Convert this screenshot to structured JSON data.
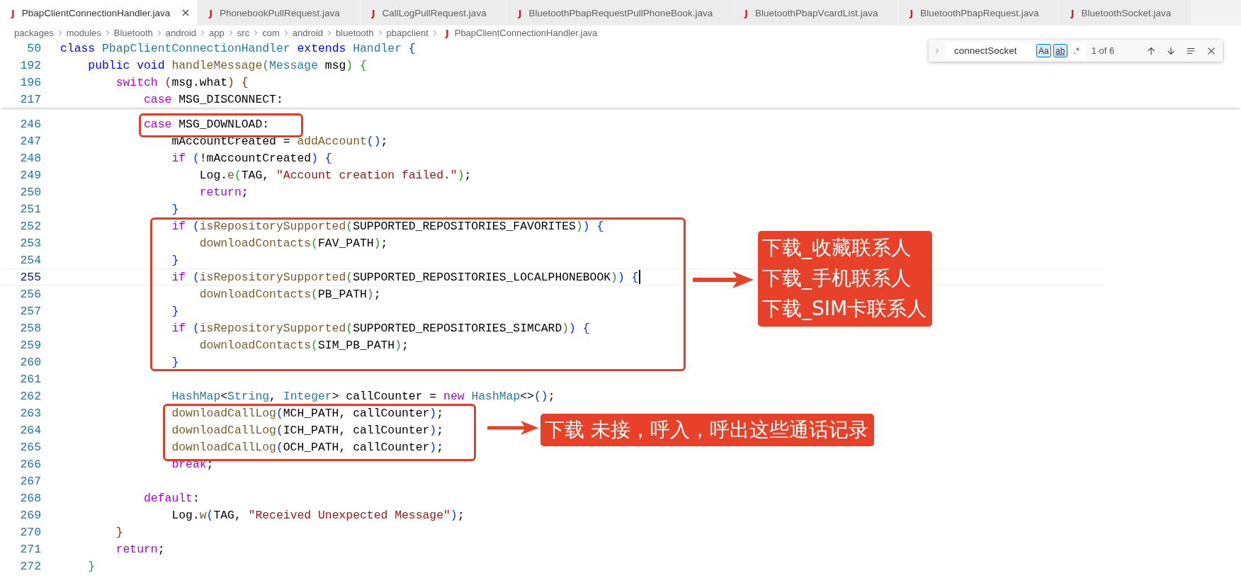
{
  "tabs": [
    {
      "icon": "J",
      "label": "PbapClientConnectionHandler.java",
      "selected": true
    },
    {
      "icon": "J",
      "label": "PhonebookPullRequest.java",
      "selected": false
    },
    {
      "icon": "J",
      "label": "CallLogPullRequest.java",
      "selected": false
    },
    {
      "icon": "J",
      "label": "BluetoothPbapRequestPullPhoneBook.java",
      "selected": false
    },
    {
      "icon": "J",
      "label": "BluetoothPbapVcardList.java",
      "selected": false
    },
    {
      "icon": "J",
      "label": "BluetoothPbapRequest.java",
      "selected": false
    },
    {
      "icon": "J",
      "label": "BluetoothSocket.java",
      "selected": false
    }
  ],
  "breadcrumb": {
    "folders": [
      "packages",
      "modules",
      "Bluetooth",
      "android",
      "app",
      "src",
      "com",
      "android",
      "bluetooth",
      "pbapclient"
    ],
    "file": {
      "icon": "J",
      "label": "PbapClientConnectionHandler.java"
    }
  },
  "find_widget": {
    "value": "connectSocket",
    "match_case": {
      "label": "Aa",
      "selected": true
    },
    "whole_word": {
      "label": "ab",
      "selected": true
    },
    "regex": {
      "label": ".*",
      "selected": false
    },
    "result": "1 of 6"
  },
  "sticky_lines": [
    {
      "number": "50",
      "tokens": [
        {
          "kind": "declaration",
          "text": "class "
        },
        {
          "kind": "type",
          "text": "PbapClientConnectionHandler "
        },
        {
          "kind": "declaration",
          "text": "extends "
        },
        {
          "kind": "type",
          "text": "Handler "
        },
        {
          "kind": "bracket1",
          "text": "{"
        }
      ]
    },
    {
      "number": "192",
      "tokens": [
        {
          "kind": "declaration",
          "text": "    public void "
        },
        {
          "kind": "method",
          "text": "handleMessage"
        },
        {
          "kind": "bracket2",
          "text": "("
        },
        {
          "kind": "type",
          "text": "Message"
        },
        {
          "kind": "plain",
          "text": " msg"
        },
        {
          "kind": "bracket2",
          "text": ") {"
        }
      ]
    },
    {
      "number": "196",
      "tokens": [
        {
          "kind": "keyword",
          "text": "        switch "
        },
        {
          "kind": "bracket3",
          "text": "("
        },
        {
          "kind": "plain",
          "text": "msg.what"
        },
        {
          "kind": "bracket3",
          "text": ") {"
        }
      ]
    },
    {
      "number": "217",
      "tokens": [
        {
          "kind": "keyword",
          "text": "            case"
        },
        {
          "kind": "plain",
          "text": " MSG_DISCONNECT:"
        }
      ]
    }
  ],
  "lines": [
    {
      "number": "246",
      "current": false,
      "tokens": [
        {
          "kind": "keyword",
          "text": "            case"
        },
        {
          "kind": "plain",
          "text": " MSG_DOWNLOAD:"
        }
      ]
    },
    {
      "number": "247",
      "current": false,
      "tokens": [
        {
          "kind": "plain",
          "text": "                mAccountCreated = "
        },
        {
          "kind": "method",
          "text": "addAccount"
        },
        {
          "kind": "bracket1",
          "text": "()"
        },
        {
          "kind": "plain",
          "text": ";"
        }
      ]
    },
    {
      "number": "248",
      "current": false,
      "tokens": [
        {
          "kind": "keyword",
          "text": "                if "
        },
        {
          "kind": "bracket1",
          "text": "("
        },
        {
          "kind": "plain",
          "text": "!mAccountCreated"
        },
        {
          "kind": "bracket1",
          "text": ") {"
        }
      ]
    },
    {
      "number": "249",
      "current": false,
      "tokens": [
        {
          "kind": "plain",
          "text": "                    Log."
        },
        {
          "kind": "method",
          "text": "e"
        },
        {
          "kind": "bracket2",
          "text": "("
        },
        {
          "kind": "plain",
          "text": "TAG, "
        },
        {
          "kind": "string",
          "text": "\"Account creation failed.\""
        },
        {
          "kind": "bracket2",
          "text": ")"
        },
        {
          "kind": "plain",
          "text": ";"
        }
      ]
    },
    {
      "number": "250",
      "current": false,
      "tokens": [
        {
          "kind": "keyword",
          "text": "                    return"
        },
        {
          "kind": "plain",
          "text": ";"
        }
      ]
    },
    {
      "number": "251",
      "current": false,
      "tokens": [
        {
          "kind": "bracket1",
          "text": "                }"
        }
      ]
    },
    {
      "number": "252",
      "current": false,
      "tokens": [
        {
          "kind": "keyword",
          "text": "                if "
        },
        {
          "kind": "bracket1",
          "text": "("
        },
        {
          "kind": "method",
          "text": "isRepositorySupported"
        },
        {
          "kind": "bracket2",
          "text": "("
        },
        {
          "kind": "plain",
          "text": "SUPPORTED_REPOSITORIES_FAVORITES"
        },
        {
          "kind": "bracket2",
          "text": ")"
        },
        {
          "kind": "bracket1",
          "text": ") {"
        }
      ]
    },
    {
      "number": "253",
      "current": false,
      "tokens": [
        {
          "kind": "method",
          "text": "                    downloadContacts"
        },
        {
          "kind": "bracket2",
          "text": "("
        },
        {
          "kind": "plain",
          "text": "FAV_PATH"
        },
        {
          "kind": "bracket2",
          "text": ")"
        },
        {
          "kind": "plain",
          "text": ";"
        }
      ]
    },
    {
      "number": "254",
      "current": false,
      "tokens": [
        {
          "kind": "bracket1",
          "text": "                }"
        }
      ]
    },
    {
      "number": "255",
      "current": true,
      "tokens": [
        {
          "kind": "keyword",
          "text": "                if "
        },
        {
          "kind": "bracket1",
          "text": "("
        },
        {
          "kind": "method",
          "text": "isRepositorySupported"
        },
        {
          "kind": "bracket2",
          "text": "("
        },
        {
          "kind": "plain",
          "text": "SUPPORTED_REPOSITORIES_LOCALPHONEBOOK"
        },
        {
          "kind": "bracket2",
          "text": ")"
        },
        {
          "kind": "bracket1",
          "text": ") {"
        }
      ]
    },
    {
      "number": "256",
      "current": false,
      "tokens": [
        {
          "kind": "method",
          "text": "                    downloadContacts"
        },
        {
          "kind": "bracket2",
          "text": "("
        },
        {
          "kind": "plain",
          "text": "PB_PATH"
        },
        {
          "kind": "bracket2",
          "text": ")"
        },
        {
          "kind": "plain",
          "text": ";"
        }
      ]
    },
    {
      "number": "257",
      "current": false,
      "tokens": [
        {
          "kind": "bracket1",
          "text": "                }"
        }
      ]
    },
    {
      "number": "258",
      "current": false,
      "tokens": [
        {
          "kind": "keyword",
          "text": "                if "
        },
        {
          "kind": "bracket1",
          "text": "("
        },
        {
          "kind": "method",
          "text": "isRepositorySupported"
        },
        {
          "kind": "bracket2",
          "text": "("
        },
        {
          "kind": "plain",
          "text": "SUPPORTED_REPOSITORIES_SIMCARD"
        },
        {
          "kind": "bracket2",
          "text": ")"
        },
        {
          "kind": "bracket1",
          "text": ") {"
        }
      ]
    },
    {
      "number": "259",
      "current": false,
      "tokens": [
        {
          "kind": "method",
          "text": "                    downloadContacts"
        },
        {
          "kind": "bracket2",
          "text": "("
        },
        {
          "kind": "plain",
          "text": "SIM_PB_PATH"
        },
        {
          "kind": "bracket2",
          "text": ")"
        },
        {
          "kind": "plain",
          "text": ";"
        }
      ]
    },
    {
      "number": "260",
      "current": false,
      "tokens": [
        {
          "kind": "bracket1",
          "text": "                }"
        }
      ]
    },
    {
      "number": "261",
      "current": false
    },
    {
      "number": "262",
      "current": false,
      "tokens": [
        {
          "kind": "type",
          "text": "                HashMap"
        },
        {
          "kind": "plain",
          "text": "<"
        },
        {
          "kind": "type",
          "text": "String"
        },
        {
          "kind": "plain",
          "text": ", "
        },
        {
          "kind": "type",
          "text": "Integer"
        },
        {
          "kind": "plain",
          "text": "> callCounter = "
        },
        {
          "kind": "keyword",
          "text": "new "
        },
        {
          "kind": "type",
          "text": "HashMap"
        },
        {
          "kind": "plain",
          "text": "<>"
        },
        {
          "kind": "bracket1",
          "text": "()"
        },
        {
          "kind": "plain",
          "text": ";"
        }
      ]
    },
    {
      "number": "263",
      "current": false,
      "tokens": [
        {
          "kind": "method",
          "text": "                downloadCallLog"
        },
        {
          "kind": "bracket1",
          "text": "("
        },
        {
          "kind": "plain",
          "text": "MCH_PATH, callCounter"
        },
        {
          "kind": "bracket1",
          "text": ")"
        },
        {
          "kind": "plain",
          "text": ";"
        }
      ]
    },
    {
      "number": "264",
      "current": false,
      "tokens": [
        {
          "kind": "method",
          "text": "                downloadCallLog"
        },
        {
          "kind": "bracket1",
          "text": "("
        },
        {
          "kind": "plain",
          "text": "ICH_PATH, callCounter"
        },
        {
          "kind": "bracket1",
          "text": ")"
        },
        {
          "kind": "plain",
          "text": ";"
        }
      ]
    },
    {
      "number": "265",
      "current": false,
      "tokens": [
        {
          "kind": "method",
          "text": "                downloadCallLog"
        },
        {
          "kind": "bracket1",
          "text": "("
        },
        {
          "kind": "plain",
          "text": "OCH_PATH, callCounter"
        },
        {
          "kind": "bracket1",
          "text": ")"
        },
        {
          "kind": "plain",
          "text": ";"
        }
      ]
    },
    {
      "number": "266",
      "current": false,
      "tokens": [
        {
          "kind": "keyword",
          "text": "                break"
        },
        {
          "kind": "plain",
          "text": ";"
        }
      ]
    },
    {
      "number": "267",
      "current": false
    },
    {
      "number": "268",
      "current": false,
      "tokens": [
        {
          "kind": "keyword",
          "text": "            default"
        },
        {
          "kind": "plain",
          "text": ":"
        }
      ]
    },
    {
      "number": "269",
      "current": false,
      "tokens": [
        {
          "kind": "plain",
          "text": "                Log."
        },
        {
          "kind": "method",
          "text": "w"
        },
        {
          "kind": "bracket1",
          "text": "("
        },
        {
          "kind": "plain",
          "text": "TAG, "
        },
        {
          "kind": "string",
          "text": "\"Received Unexpected Message\""
        },
        {
          "kind": "bracket1",
          "text": ")"
        },
        {
          "kind": "plain",
          "text": ";"
        }
      ]
    },
    {
      "number": "270",
      "current": false,
      "tokens": [
        {
          "kind": "bracket3",
          "text": "        }"
        }
      ]
    },
    {
      "number": "271",
      "current": false,
      "tokens": [
        {
          "kind": "keyword",
          "text": "        return"
        },
        {
          "kind": "plain",
          "text": ";"
        }
      ]
    },
    {
      "number": "272",
      "current": false,
      "tokens": [
        {
          "kind": "bracket2",
          "text": "    }"
        }
      ]
    }
  ],
  "callouts": [
    {
      "lines": [
        "下载_收藏联系人",
        "下载_手机联系人",
        "下载_SIM卡联系人"
      ]
    },
    {
      "lines": [
        "下载 未接，呼入，呼出这些通话记录"
      ]
    }
  ]
}
